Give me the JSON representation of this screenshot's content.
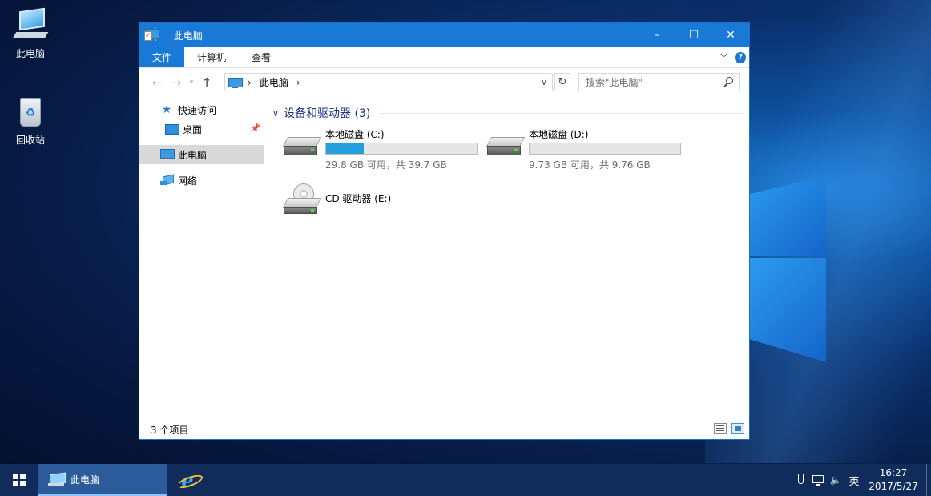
{
  "desktop": {
    "icons": [
      {
        "label": "此电脑"
      },
      {
        "label": "回收站"
      }
    ]
  },
  "window": {
    "title": "此电脑",
    "ribbon": {
      "tabs": [
        {
          "label": "文件"
        },
        {
          "label": "计算机"
        },
        {
          "label": "查看"
        }
      ]
    },
    "address": {
      "path": "此电脑"
    },
    "search": {
      "placeholder": "搜索\"此电脑\""
    },
    "nav": {
      "quick_access": "快速访问",
      "desktop": "桌面",
      "this_pc": "此电脑",
      "network": "网络"
    },
    "group": {
      "title": "设备和驱动器 (3)"
    },
    "drives": [
      {
        "name": "本地磁盘 (C:)",
        "free": "29.8 GB 可用，共 39.7 GB",
        "used_fraction": 0.25
      },
      {
        "name": "本地磁盘 (D:)",
        "free": "9.73 GB 可用，共 9.76 GB",
        "used_fraction": 0.003
      },
      {
        "name": "CD 驱动器 (E:)"
      }
    ],
    "status": "3 个项目"
  },
  "taskbar": {
    "task_label": "此电脑",
    "lang": "英",
    "time": "16:27",
    "date": "2017/5/27"
  }
}
